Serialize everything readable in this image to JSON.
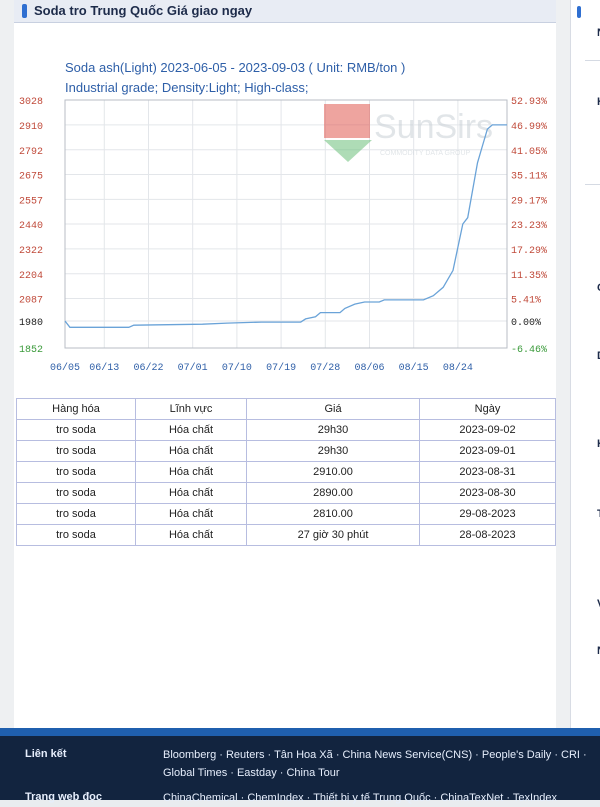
{
  "header": {
    "title": "Soda tro Trung Quốc Giá giao ngay"
  },
  "chart_caption": {
    "line1": "Soda ash(Light) 2023-06-05 - 2023-09-03    ( Unit: RMB/ton )",
    "line2": "Industrial grade; Density:Light; High-class;"
  },
  "watermark": {
    "brand": "SunSirs",
    "tagline": "COMMODITY DATA GROUP"
  },
  "chart_data": {
    "type": "line",
    "title": "Soda ash(Light) 2023-06-05 - 2023-09-03",
    "unit": "RMB/ton",
    "subtitle": "Industrial grade; Density:Light; High-class;",
    "x_range": [
      "2023-06-05",
      "2023-09-03"
    ],
    "x_ticks": [
      "06/05",
      "06/13",
      "06/22",
      "07/01",
      "07/10",
      "07/19",
      "07/28",
      "08/06",
      "08/15",
      "08/24"
    ],
    "y_ticks_left": [
      "3028",
      "2910",
      "2792",
      "2675",
      "2557",
      "2440",
      "2322",
      "2204",
      "2087",
      "1980",
      "1852"
    ],
    "y_ticks_right": [
      "52.93%",
      "46.99%",
      "41.05%",
      "35.11%",
      "29.17%",
      "23.23%",
      "17.29%",
      "11.35%",
      "5.41%",
      "0.00%",
      "-6.46%"
    ],
    "ylim": [
      1852,
      3028
    ],
    "grid": true,
    "series": [
      {
        "color": "#6aa3d8",
        "points": [
          {
            "x": "2023-06-05",
            "y": 1980
          },
          {
            "x": "2023-06-06",
            "y": 1950
          },
          {
            "x": "2023-06-18",
            "y": 1950
          },
          {
            "x": "2023-06-19",
            "y": 1960
          },
          {
            "x": "2023-07-03",
            "y": 1965
          },
          {
            "x": "2023-07-08",
            "y": 1970
          },
          {
            "x": "2023-07-15",
            "y": 1975
          },
          {
            "x": "2023-07-23",
            "y": 1975
          },
          {
            "x": "2023-07-24",
            "y": 1990
          },
          {
            "x": "2023-07-26",
            "y": 2000
          },
          {
            "x": "2023-07-27",
            "y": 2020
          },
          {
            "x": "2023-07-31",
            "y": 2020
          },
          {
            "x": "2023-08-01",
            "y": 2040
          },
          {
            "x": "2023-08-03",
            "y": 2060
          },
          {
            "x": "2023-08-05",
            "y": 2070
          },
          {
            "x": "2023-08-08",
            "y": 2070
          },
          {
            "x": "2023-08-09",
            "y": 2080
          },
          {
            "x": "2023-08-17",
            "y": 2080
          },
          {
            "x": "2023-08-19",
            "y": 2100
          },
          {
            "x": "2023-08-21",
            "y": 2140
          },
          {
            "x": "2023-08-23",
            "y": 2220
          },
          {
            "x": "2023-08-25",
            "y": 2440
          },
          {
            "x": "2023-08-26",
            "y": 2470
          },
          {
            "x": "2023-08-28",
            "y": 2730
          },
          {
            "x": "2023-08-29",
            "y": 2810
          },
          {
            "x": "2023-08-30",
            "y": 2890
          },
          {
            "x": "2023-08-31",
            "y": 2910
          },
          {
            "x": "2023-09-03",
            "y": 2910
          }
        ]
      }
    ]
  },
  "table": {
    "headers": [
      "Hàng hóa",
      "Lĩnh vực",
      "Giá",
      "Ngày"
    ],
    "rows": [
      [
        "tro soda",
        "Hóa chất",
        "29h30",
        "2023-09-02"
      ],
      [
        "tro soda",
        "Hóa chất",
        "29h30",
        "2023-09-01"
      ],
      [
        "tro soda",
        "Hóa chất",
        "2910.00",
        "2023-08-31"
      ],
      [
        "tro soda",
        "Hóa chất",
        "2890.00",
        "2023-08-30"
      ],
      [
        "tro soda",
        "Hóa chất",
        "2810.00",
        "29-08-2023"
      ],
      [
        "tro soda",
        "Hóa chất",
        "27 giờ 30 phút",
        "28-08-2023"
      ]
    ]
  },
  "right_column": {
    "letters": [
      "N",
      "H",
      "C",
      "D",
      "K",
      "T",
      "V",
      "N"
    ]
  },
  "footer": {
    "links_label": "Liên kết",
    "links_line1": "Bloomberg · Reuters · Tân Hoa Xã · China News Service(CNS) · People's Daily · CRI ·",
    "links_line2": "Global Times · Eastday · China Tour",
    "web_label": "Trang web đọc",
    "web_line1": "ChinaChemical · ChemIndex · Thiết bị y tế Trung Quốc · ChinaTexNet · TexIndex"
  }
}
